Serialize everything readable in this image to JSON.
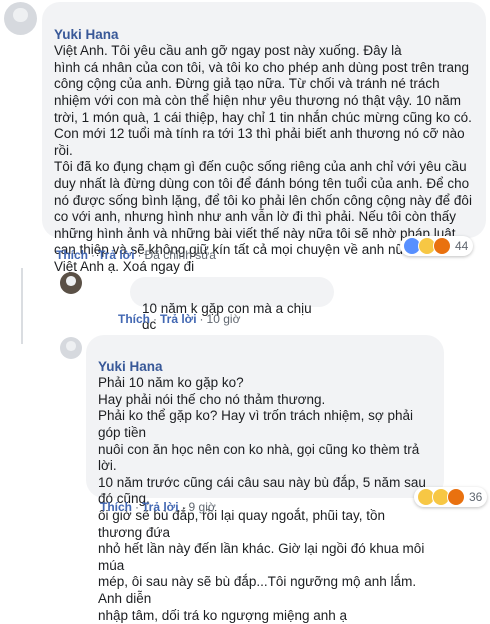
{
  "comments": [
    {
      "author": "Yuki Hana",
      "text": "Việt Anh. Tôi yêu cầu anh gỡ ngay post này xuống. Đây là\nhình cá nhân của con tôi, và tôi ko cho phép anh dùng post trên trang\ncông cộng của anh. Đừng giả tạo nữa. Từ chối và tránh né trách\nnhiệm với con mà còn thể hiện như yêu thương nó thật vậy. 10 năm\ntrời, 1 món quà, 1 cái thiệp, hay chỉ 1 tin nhắn chúc mừng cũng ko có.\nCon mới 12 tuổi mà tính ra tới 13 thì phải biết anh thương nó cỡ nào\nrồi.\nTôi đã ko đụng chạm gì đến cuộc sống riêng của anh chỉ với yêu cầu\nduy nhất là đừng dùng con tôi để đánh bóng tên tuổi của anh. Để cho\nnó được sống bình lặng, để tôi ko phải lên chốn công cộng này để đôi\nco với anh, nhưng hình như anh vẫn lờ đi thì phải. Nếu tôi còn thấy\nnhững hình ảnh và những bài viết thế này nữa tôi sẽ nhờ pháp luật\ncan thiệp và sẽ không giữ kín tất cả mọi chuyện về anh nữa đâu anh\nViệt Anh ạ. Xoá ngay đi",
      "actions": [
        "Thích",
        "Trả lời",
        "Đã chỉnh sửa"
      ],
      "reaction_count": "44"
    },
    {
      "author": "",
      "text": "10 năm k gặp con mà a chịu dc",
      "actions": [
        "Thích",
        "Trả lời",
        "10 giờ"
      ]
    },
    {
      "author": "Yuki Hana",
      "text": "Phải 10 năm ko gặp ko?\nHay phải nói thế cho nó thảm thương.\nPhải ko thể gặp ko? Hay vì trốn trách nhiệm, sợ phải góp tiền\nnuôi con ăn học nên con ko nhà, gọi cũng ko thèm trả lời.\n10 năm trước cũng cái câu sau này bù đắp, 5 năm sau đó cũng,\nôi giờ sẽ bù đắp, rồi lại quay ngoắt, phũi tay, tồn thương đứa\nnhỏ hết lần này đến lần khác. Giờ lại ngồi đó khua môi múa\nmép, ôi sau này sẽ bù đắp...Tôi ngưỡng mộ anh lắm. Anh diễn\nnhập tâm, dối trá ko ngượng miệng anh ạ",
      "actions": [
        "Thích",
        "Trả lời",
        "9 giờ"
      ],
      "reaction_count": "36"
    }
  ]
}
